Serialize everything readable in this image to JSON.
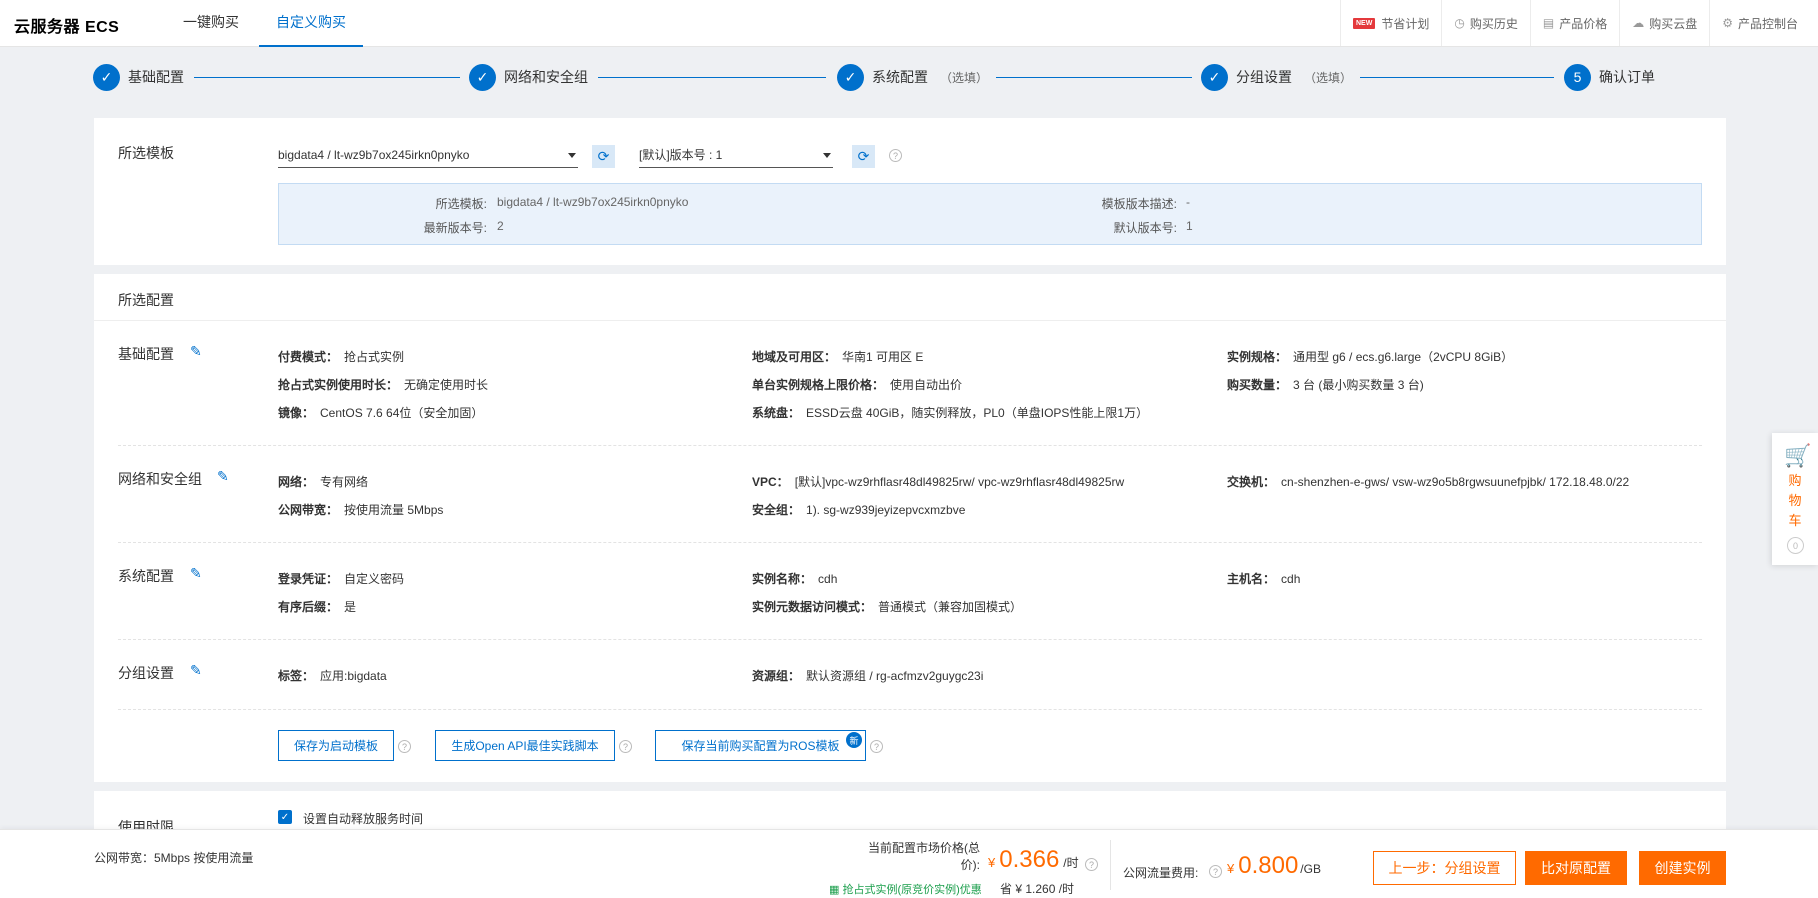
{
  "header": {
    "brand": "云服务器 ECS",
    "tabs": [
      {
        "label": "一键购买"
      },
      {
        "label": "自定义购买"
      }
    ],
    "right_links": [
      {
        "label": "节省计划",
        "badge": "NEW"
      },
      {
        "label": "购买历史",
        "icon": "clock-icon"
      },
      {
        "label": "产品价格",
        "icon": "document-icon"
      },
      {
        "label": "购买云盘",
        "icon": "cloud-icon"
      },
      {
        "label": "产品控制台",
        "icon": "gear-icon"
      }
    ]
  },
  "steps": [
    {
      "label": "基础配置",
      "done": true
    },
    {
      "label": "网络和安全组",
      "done": true
    },
    {
      "label": "系统配置",
      "optional": "（选填）",
      "done": true
    },
    {
      "label": "分组设置",
      "optional": "（选填）",
      "done": true
    },
    {
      "label": "确认订单",
      "number": "5"
    }
  ],
  "template": {
    "label": "所选模板",
    "template_select": "bigdata4 / lt-wz9b7ox245irkn0pnyko",
    "version_select": "[默认]版本号 : 1",
    "info": {
      "selected_template_key": "所选模板:",
      "selected_template_value": "bigdata4 / lt-wz9b7ox245irkn0pnyko",
      "latest_version_key": "最新版本号:",
      "latest_version_value": "2",
      "version_desc_key": "模板版本描述:",
      "version_desc_value": "-",
      "default_version_key": "默认版本号:",
      "default_version_value": "1"
    }
  },
  "config": {
    "title": "所选配置",
    "basic": {
      "title": "基础配置",
      "items": [
        {
          "k": "付费模式：",
          "v": "抢占式实例"
        },
        {
          "k": "地域及可用区：",
          "v": "华南1 可用区 E"
        },
        {
          "k": "实例规格：",
          "v": "通用型 g6 / ecs.g6.large（2vCPU 8GiB）"
        },
        {
          "k": "抢占式实例使用时长：",
          "v": "无确定使用时长"
        },
        {
          "k": "单台实例规格上限价格：",
          "v": "使用自动出价"
        },
        {
          "k": "购买数量：",
          "v": "3 台 (最小购买数量 3 台)"
        },
        {
          "k": "镜像：",
          "v": "CentOS 7.6 64位（安全加固）"
        },
        {
          "k": "系统盘：",
          "v": "ESSD云盘 40GiB，随实例释放，PL0（单盘IOPS性能上限1万）"
        }
      ]
    },
    "network": {
      "title": "网络和安全组",
      "items": [
        {
          "k": "网络：",
          "v": "专有网络"
        },
        {
          "k": "VPC：",
          "v": "[默认]vpc-wz9rhflasr48dl49825rw/ vpc-wz9rhflasr48dl49825rw"
        },
        {
          "k": "交换机：",
          "v": "cn-shenzhen-e-gws/ vsw-wz9o5b8rgwsuunefpjbk/ 172.18.48.0/22"
        },
        {
          "k": "公网带宽：",
          "v": "按使用流量 5Mbps"
        },
        {
          "k": "安全组：",
          "v": "1). sg-wz939jeyizepvcxmzbve"
        }
      ]
    },
    "system": {
      "title": "系统配置",
      "items": [
        {
          "k": "登录凭证：",
          "v": "自定义密码"
        },
        {
          "k": "实例名称：",
          "v": "cdh"
        },
        {
          "k": "主机名：",
          "v": "cdh"
        },
        {
          "k": "有序后缀：",
          "v": "是"
        },
        {
          "k": "实例元数据访问模式：",
          "v": "普通模式（兼容加固模式）"
        }
      ]
    },
    "group": {
      "title": "分组设置",
      "items": [
        {
          "k": "标签：",
          "v": "应用:bigdata"
        },
        {
          "k": "资源组：",
          "v": "默认资源组 / rg-acfmzv2guygc23i"
        }
      ]
    },
    "actions": {
      "save_template": "保存为启动模板",
      "gen_api": "生成Open API最佳实践脚本",
      "save_ros": "保存当前购买配置为ROS模板",
      "new_badge": "新"
    }
  },
  "usage": {
    "title": "使用时限",
    "auto_release": "设置自动释放服务时间",
    "auto_release_checked": true
  },
  "footer": {
    "bandwidth": "公网带宽：5Mbps 按使用流量",
    "market_price_label_1": "当前配置市场价格(总",
    "market_price_label_2": "价):",
    "currency": "¥",
    "price": "0.366",
    "per_hour": "/时",
    "discount_note": "抢占式实例(原竞价实例)优惠",
    "save_label": "省 ¥ 1.260 /时",
    "traffic_label": "公网流量费用:",
    "traffic_price": "0.800",
    "per_gb": "/GB",
    "prev_button": "上一步：分组设置",
    "compare_button": "比对原配置",
    "create_button": "创建实例"
  },
  "cart": {
    "label_1": "购",
    "label_2": "物",
    "label_3": "车",
    "count": "0"
  },
  "colors": {
    "primary": "#0070cc",
    "accent": "#ff6a00",
    "info_bg": "#eaf2fb"
  }
}
